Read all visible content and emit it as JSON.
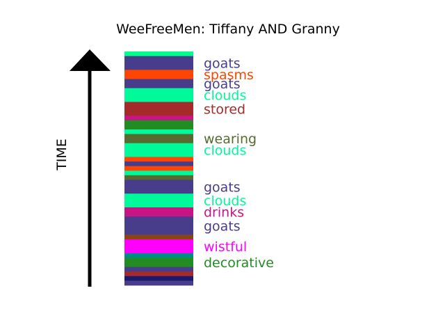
{
  "chart_data": {
    "type": "bar",
    "title": "WeeFreeMen: Tiffany AND Granny",
    "ylabel": "TIME",
    "time_direction": "up",
    "segments": [
      {
        "label": "",
        "color": "#00FF88",
        "duration": 1
      },
      {
        "label": "goats",
        "color": "#483D8B",
        "duration": 3
      },
      {
        "label": "spasms",
        "color": "#FF4500",
        "duration": 2
      },
      {
        "label": "goats",
        "color": "#483D8B",
        "duration": 2
      },
      {
        "label": "clouds",
        "color": "#00FA9A",
        "duration": 3
      },
      {
        "label": "stored",
        "color": "#A52A2A",
        "duration": 3
      },
      {
        "label": "",
        "color": "#C71585",
        "duration": 1
      },
      {
        "label": "",
        "color": "#228B22",
        "duration": 2
      },
      {
        "label": "",
        "color": "#00FA9A",
        "duration": 1
      },
      {
        "label": "wearing",
        "color": "#556B2F",
        "duration": 2
      },
      {
        "label": "clouds",
        "color": "#00FA9A",
        "duration": 3
      },
      {
        "label": "",
        "color": "#FF4500",
        "duration": 1
      },
      {
        "label": "",
        "color": "#483D8B",
        "duration": 1
      },
      {
        "label": "",
        "color": "#FF4500",
        "duration": 1
      },
      {
        "label": "",
        "color": "#00FA9A",
        "duration": 1
      },
      {
        "label": "",
        "color": "#556B2F",
        "duration": 1
      },
      {
        "label": "goats",
        "color": "#483D8B",
        "duration": 3
      },
      {
        "label": "clouds",
        "color": "#00FA9A",
        "duration": 3
      },
      {
        "label": "drinks",
        "color": "#C71585",
        "duration": 2
      },
      {
        "label": "goats",
        "color": "#483D8B",
        "duration": 4
      },
      {
        "label": "",
        "color": "#8B4513",
        "duration": 1
      },
      {
        "label": "wistful",
        "color": "#FF00FF",
        "duration": 3
      },
      {
        "label": "",
        "color": "#008B8B",
        "duration": 1
      },
      {
        "label": "decorative",
        "color": "#228B22",
        "duration": 2
      },
      {
        "label": "",
        "color": "#483D8B",
        "duration": 1
      },
      {
        "label": "",
        "color": "#A52A2A",
        "duration": 1
      },
      {
        "label": "",
        "color": "#191970",
        "duration": 1
      },
      {
        "label": "",
        "color": "#483D8B",
        "duration": 1
      }
    ]
  }
}
